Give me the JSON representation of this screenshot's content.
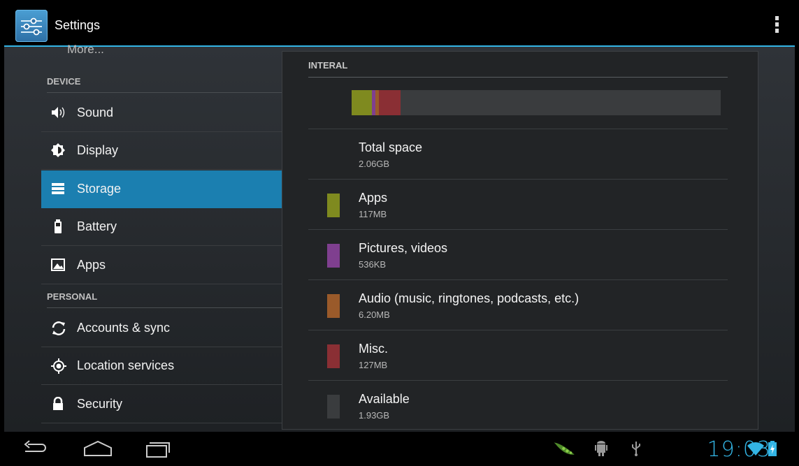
{
  "actionbar": {
    "title": "Settings",
    "icon": "settings-sliders-icon"
  },
  "left": {
    "more_label": "More...",
    "device_header": "DEVICE",
    "personal_header": "PERSONAL",
    "items": [
      {
        "label": "Sound",
        "icon": "volume-icon"
      },
      {
        "label": "Display",
        "icon": "brightness-icon"
      },
      {
        "label": "Storage",
        "icon": "storage-icon",
        "selected": true
      },
      {
        "label": "Battery",
        "icon": "battery-icon"
      },
      {
        "label": "Apps",
        "icon": "apps-icon"
      },
      {
        "label": "Accounts & sync",
        "icon": "sync-icon"
      },
      {
        "label": "Location services",
        "icon": "location-icon"
      },
      {
        "label": "Security",
        "icon": "lock-icon"
      }
    ]
  },
  "storage": {
    "header": "INTERAL",
    "total": {
      "title": "Total space",
      "value": "2.06GB"
    },
    "rows": [
      {
        "title": "Apps",
        "value": "117MB",
        "color": "#7f8a1f"
      },
      {
        "title": "Pictures, videos",
        "value": "536KB",
        "color": "#7f3f8f"
      },
      {
        "title": "Audio (music, ringtones, podcasts, etc.)",
        "value": "6.20MB",
        "color": "#9a5a2a"
      },
      {
        "title": "Misc.",
        "value": "127MB",
        "color": "#8a2f34"
      },
      {
        "title": "Available",
        "value": "1.93GB",
        "color": "#3a3c3e"
      }
    ],
    "usage_segments": [
      {
        "name": "Apps",
        "fraction": 0.055,
        "color": "#7f8a1f"
      },
      {
        "name": "Pictures, videos",
        "fraction": 0.01,
        "color": "#7f3f8f"
      },
      {
        "name": "Audio",
        "fraction": 0.008,
        "color": "#9a5a2a"
      },
      {
        "name": "Misc.",
        "fraction": 0.06,
        "color": "#8a2f34"
      }
    ]
  },
  "systembar": {
    "clock": "19:03",
    "accent": "#33b5e5",
    "nav": [
      "back-icon",
      "home-icon",
      "recent-apps-icon"
    ],
    "status_icons": [
      "notification-pea-icon",
      "android-debug-icon",
      "usb-icon",
      "wifi-icon",
      "battery-charging-icon"
    ]
  }
}
